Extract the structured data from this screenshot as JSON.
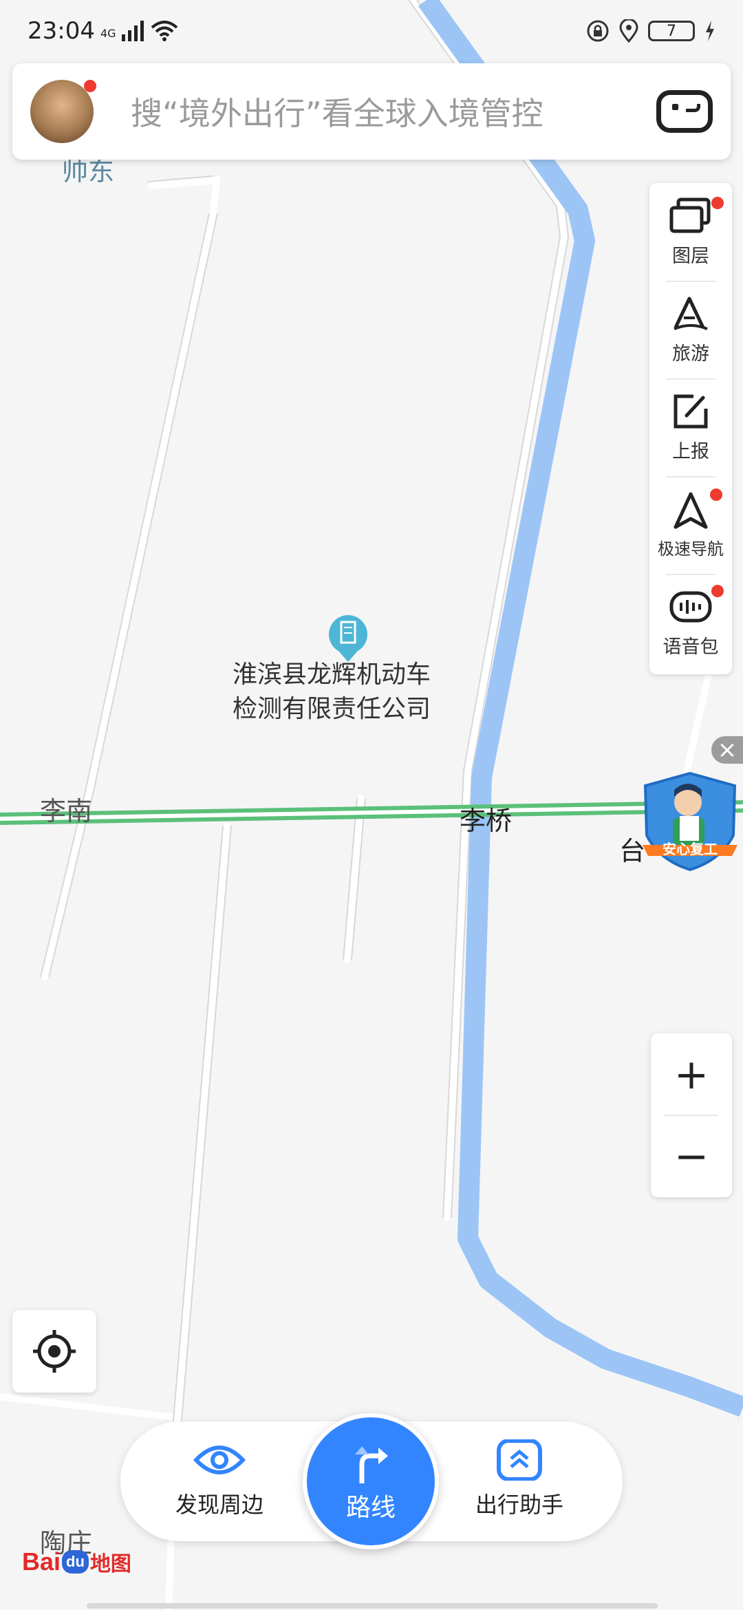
{
  "status_bar": {
    "time": "23:04",
    "network": "4G",
    "battery_level": "7"
  },
  "search": {
    "placeholder": "搜“境外出行”看全球入境管控"
  },
  "right_panel": {
    "items": [
      {
        "label": "图层",
        "icon": "layers-icon",
        "has_badge": true
      },
      {
        "label": "旅游",
        "icon": "travel-icon",
        "has_badge": false
      },
      {
        "label": "上报",
        "icon": "report-icon",
        "has_badge": false
      },
      {
        "label": "极速导航",
        "icon": "navigation-icon",
        "has_badge": true
      },
      {
        "label": "语音包",
        "icon": "voice-pack-icon",
        "has_badge": true
      }
    ]
  },
  "zoom": {
    "in_label": "+",
    "out_label": "−"
  },
  "map": {
    "poi_name_line1": "淮滨县龙辉机动车",
    "poi_name_line2": "检测有限责任公司",
    "labels": {
      "top_left": "帅东",
      "li_nan": "李南",
      "li_qiao": "李桥",
      "tai": "台",
      "tao_zhuang": "陶庄"
    },
    "road_color": "#5bc07a",
    "river_color": "#9cc5f6"
  },
  "ad": {
    "badge_text": "安心复工"
  },
  "bottom_bar": {
    "discover_label": "发现周边",
    "route_label": "路线",
    "assistant_label": "出行助手"
  },
  "logo": {
    "bai": "Bai",
    "du": "du",
    "ditu": "地图"
  },
  "colors": {
    "accent": "#3385ff",
    "badge_red": "#ee3a2f"
  }
}
